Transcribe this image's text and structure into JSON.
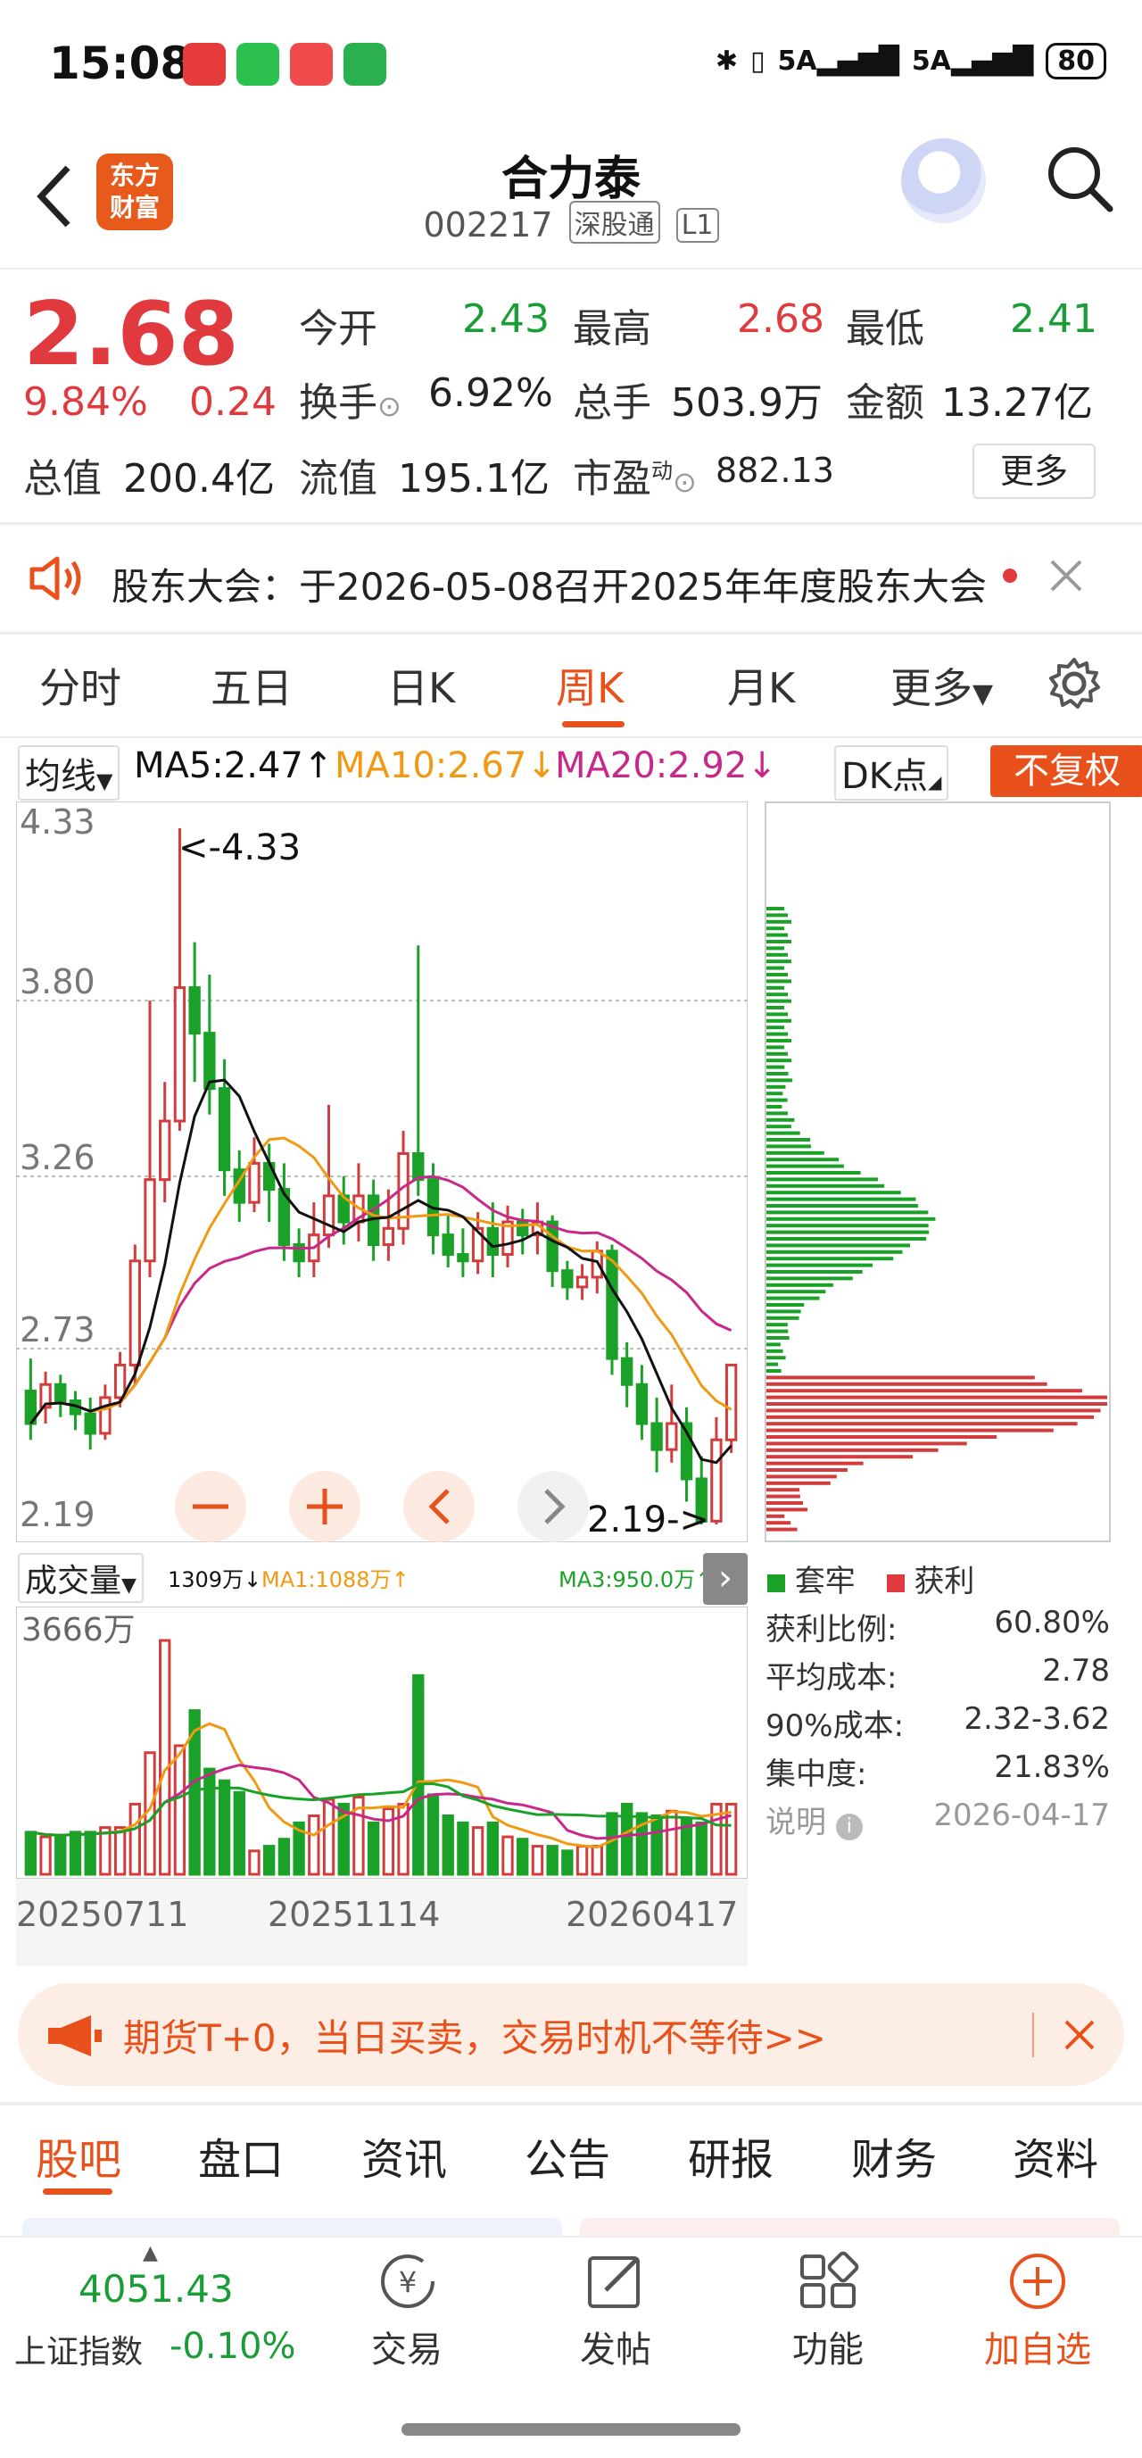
{
  "status_bar": {
    "time": "15:08",
    "network": "5A",
    "network2": "5A",
    "battery": "80"
  },
  "header": {
    "logo_line1": "东方",
    "logo_line2": "财富",
    "stock_name": "合力泰",
    "stock_code": "002217",
    "tag1": "深股通",
    "tag2": "L1"
  },
  "quote": {
    "price": "2.68",
    "change_pct": "9.84%",
    "change": "0.24",
    "open_label": "今开",
    "open": "2.43",
    "high_label": "最高",
    "high": "2.68",
    "low_label": "最低",
    "low": "2.41",
    "turnover_label": "换手",
    "turnover": "6.92%",
    "volume_label": "总手",
    "volume": "503.9万",
    "amount_label": "金额",
    "amount": "13.27亿",
    "mktcap_label": "总值",
    "mktcap": "200.4亿",
    "float_label": "流值",
    "float": "195.1亿",
    "pe_label": "市盈",
    "pe_sup": "动",
    "pe": "882.13",
    "more": "更多"
  },
  "notice": {
    "text": "股东大会：于2026-05-08召开2025年年度股东大会"
  },
  "ktabs": [
    "分时",
    "五日",
    "日K",
    "周K",
    "月K",
    "更多"
  ],
  "ma_row": {
    "ma_select": "均线",
    "ma5": "MA5:2.47",
    "ma10": "MA10:2.67",
    "ma20": "MA20:2.92",
    "dk": "DK点",
    "fuquan": "不复权"
  },
  "kchart": {
    "y_labels": [
      "4.33",
      "3.80",
      "3.26",
      "2.73",
      "2.19"
    ],
    "high_marker": "<-4.33",
    "low_marker": "2.19->",
    "colors": {
      "up": "#d23c3c",
      "down": "#1aa128",
      "ma5": "#111111",
      "ma10": "#f09a14",
      "ma20": "#c8288a"
    }
  },
  "volume_row": {
    "select": "成交量",
    "vol": "1309万",
    "ma1": "MA1:1088万",
    "ma3": "MA3:950.0万",
    "max": "3666万"
  },
  "x_dates": [
    "20250711",
    "20251114",
    "20260417"
  ],
  "chips": {
    "legend_trapped": "套牢",
    "legend_profit": "获利",
    "rows": [
      {
        "label": "获利比例:",
        "value": "60.80%"
      },
      {
        "label": "平均成本:",
        "value": "2.78"
      },
      {
        "label": "90%成本:",
        "value": "2.32-3.62"
      },
      {
        "label": "集中度:",
        "value": "21.83%"
      }
    ],
    "note_label": "说明",
    "date": "2026-04-17"
  },
  "promo": {
    "text": "期货T+0，当日买卖，交易时机不等待>>"
  },
  "bottom_tabs": [
    "股吧",
    "盘口",
    "资讯",
    "公告",
    "研报",
    "财务",
    "资料"
  ],
  "dock": {
    "index_value": "4051.43",
    "index_name": "上证指数",
    "index_change": "-0.10%",
    "trade": "交易",
    "post": "发帖",
    "func": "功能",
    "add": "加自选"
  }
}
